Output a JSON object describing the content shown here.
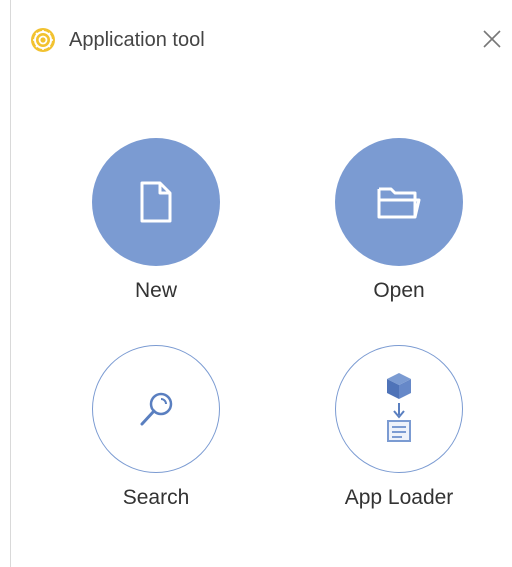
{
  "window": {
    "title": "Application tool",
    "app_icon": "app-logo-icon",
    "close_icon": "close-icon"
  },
  "tiles": [
    {
      "label": "New",
      "icon": "new-file-icon",
      "style": "filled",
      "color": "#7b9bd2"
    },
    {
      "label": "Open",
      "icon": "folder-open-icon",
      "style": "filled",
      "color": "#7b9bd2"
    },
    {
      "label": "Search",
      "icon": "search-icon",
      "style": "outline",
      "color": "#7b9bd2"
    },
    {
      "label": "App Loader",
      "icon": "app-loader-icon",
      "style": "outline",
      "color": "#7b9bd2"
    }
  ],
  "colors": {
    "accent": "#7b9bd2",
    "logo": "#f2c230",
    "text": "#333333"
  }
}
